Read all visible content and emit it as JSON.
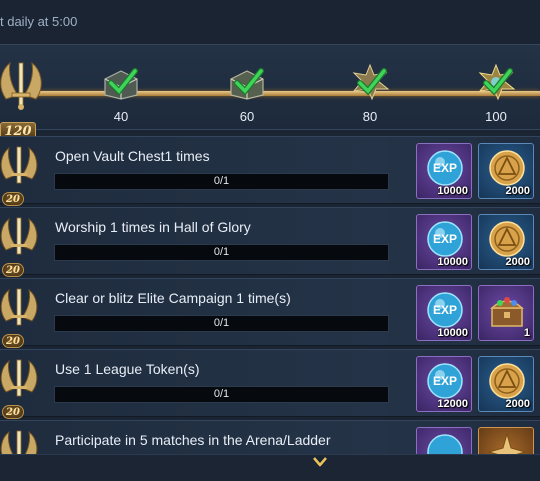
{
  "header": {
    "reset_text": "t daily at 5:00"
  },
  "activity": {
    "total": "120",
    "milestones": [
      {
        "value": "40",
        "claimed": true
      },
      {
        "value": "60",
        "claimed": true
      },
      {
        "value": "80",
        "claimed": true
      },
      {
        "value": "100",
        "claimed": true
      }
    ]
  },
  "tasks": [
    {
      "points": "20",
      "title": "Open Vault Chest1 times",
      "progress": "0/1",
      "progress_fraction": 0,
      "rewards": [
        {
          "icon": "exp-orb-icon",
          "frame": "purple",
          "qty": "10000"
        },
        {
          "icon": "gold-coin-icon",
          "frame": "blue",
          "qty": "2000"
        }
      ]
    },
    {
      "points": "20",
      "title": "Worship 1 times in Hall of Glory",
      "progress": "0/1",
      "progress_fraction": 0,
      "rewards": [
        {
          "icon": "exp-orb-icon",
          "frame": "purple",
          "qty": "10000"
        },
        {
          "icon": "gold-coin-icon",
          "frame": "blue",
          "qty": "2000"
        }
      ]
    },
    {
      "points": "20",
      "title": "Clear or blitz Elite Campaign 1 time(s)",
      "progress": "0/1",
      "progress_fraction": 0,
      "rewards": [
        {
          "icon": "exp-orb-icon",
          "frame": "purple",
          "qty": "10000"
        },
        {
          "icon": "treasure-chest-icon",
          "frame": "purple",
          "qty": "1"
        }
      ]
    },
    {
      "points": "20",
      "title": "Use 1 League Token(s)",
      "progress": "0/1",
      "progress_fraction": 0,
      "rewards": [
        {
          "icon": "exp-orb-icon",
          "frame": "purple",
          "qty": "12000"
        },
        {
          "icon": "gold-coin-icon",
          "frame": "blue",
          "qty": "2000"
        }
      ]
    },
    {
      "points": "20",
      "title": "Participate in 5 matches in the Arena/Ladder",
      "progress": "",
      "progress_fraction": 0,
      "rewards": [
        {
          "icon": "exp-orb-icon",
          "frame": "purple",
          "qty": ""
        },
        {
          "icon": "compass-emblem-icon",
          "frame": "orange",
          "qty": ""
        }
      ]
    }
  ],
  "colors": {
    "accent_gold": "#e0b76a",
    "check_green": "#33c24a",
    "panel_bg": "#1a2433"
  },
  "exp_label": "EXP"
}
